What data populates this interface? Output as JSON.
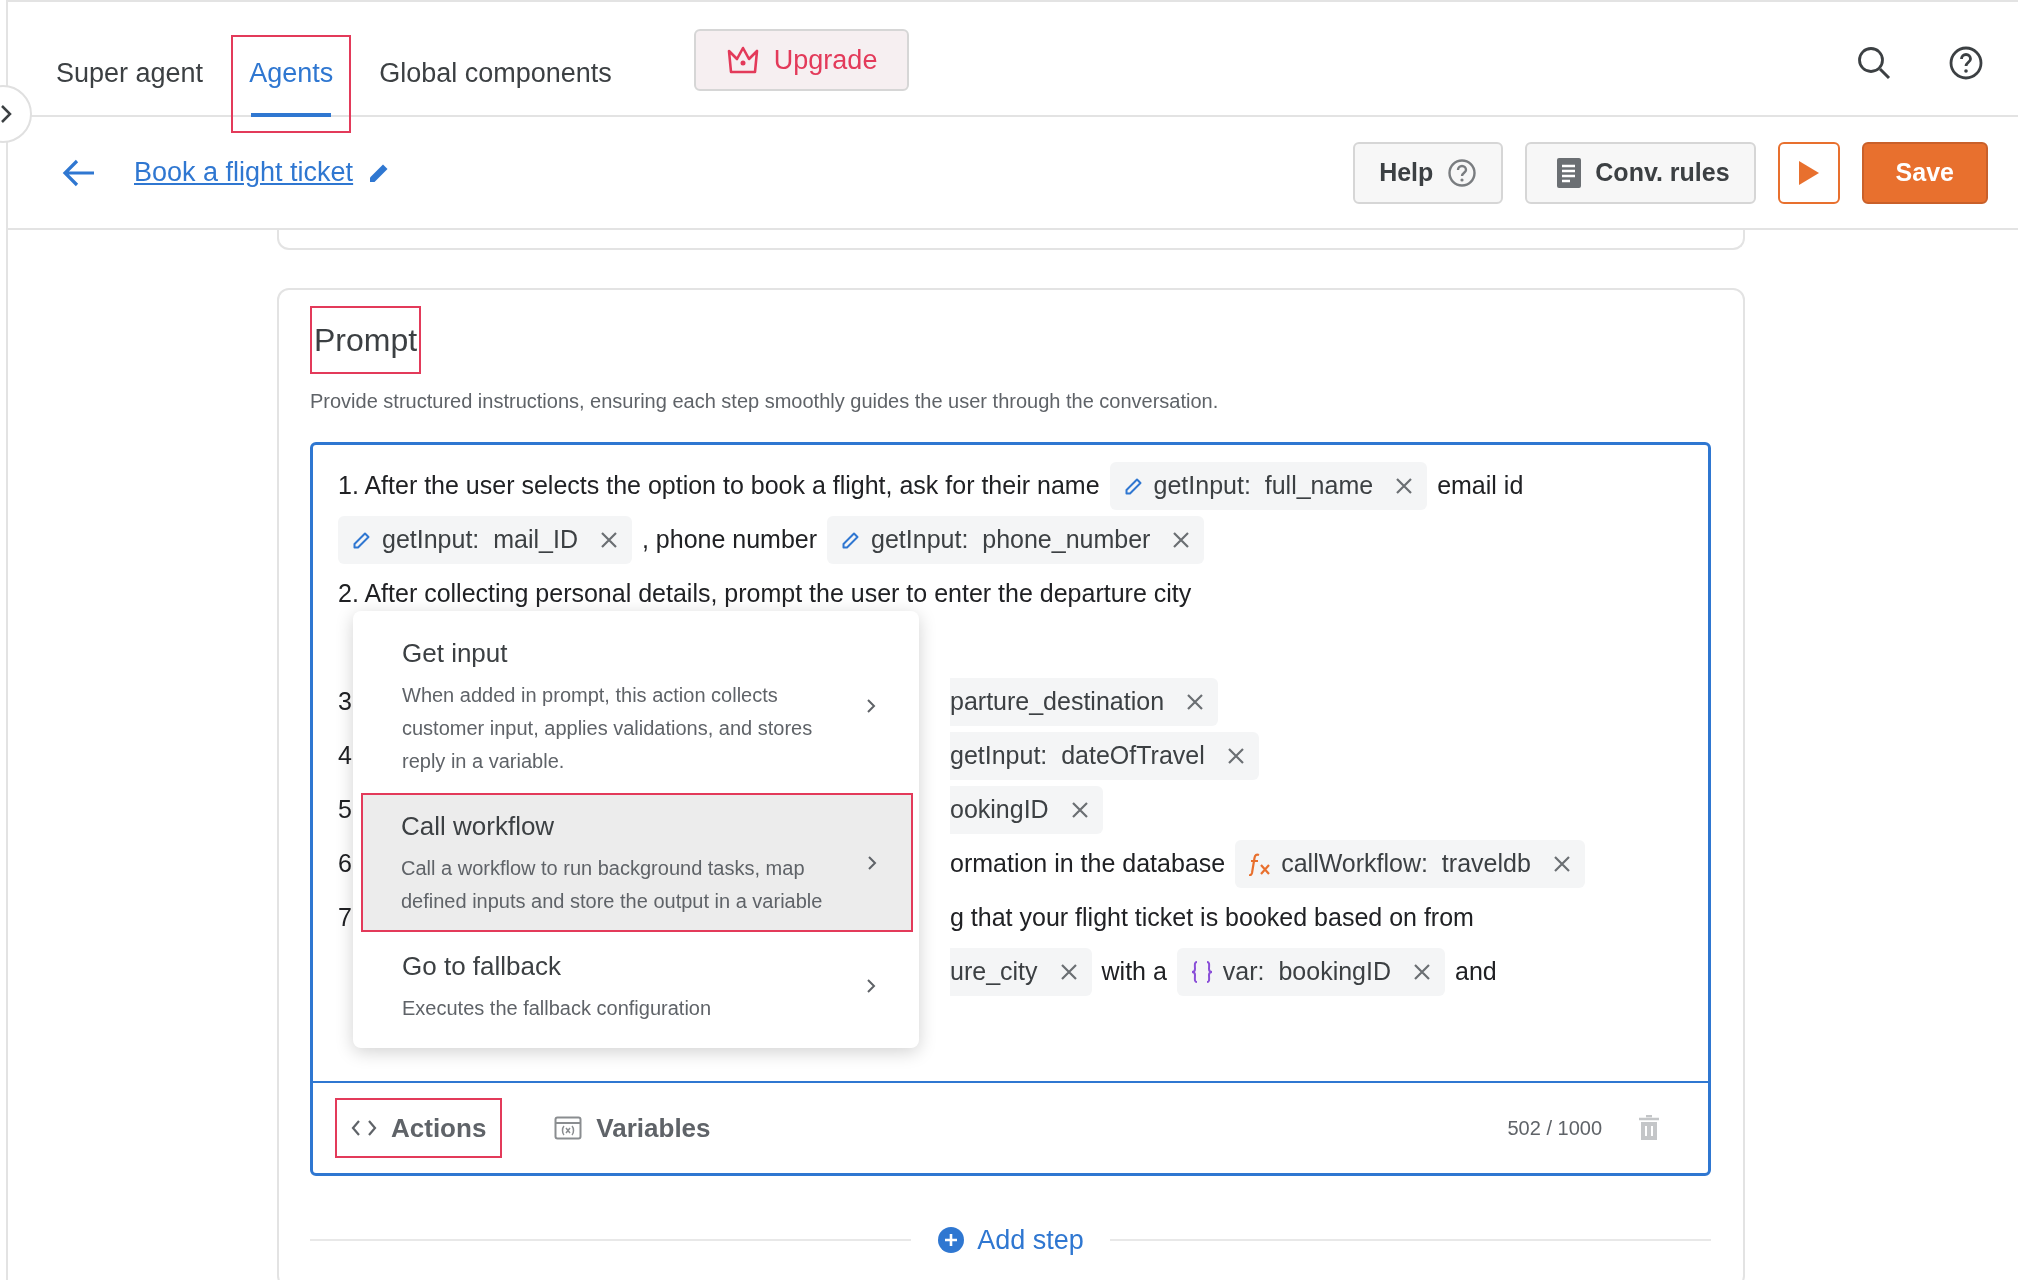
{
  "top_nav": {
    "tabs": [
      {
        "label": "Super agent",
        "selected": false,
        "highlighted": false
      },
      {
        "label": "Agents",
        "selected": true,
        "highlighted": true
      },
      {
        "label": "Global components",
        "selected": false,
        "highlighted": false
      }
    ],
    "upgrade_button": "Upgrade"
  },
  "toolbar": {
    "title": "Book a flight ticket",
    "buttons": [
      {
        "kind": "help",
        "label": "Help"
      },
      {
        "kind": "rules",
        "label": "Conv. rules"
      },
      {
        "kind": "play"
      },
      {
        "kind": "save",
        "label": "Save"
      }
    ]
  },
  "prompt": {
    "title": "Prompt",
    "title_highlighted": true,
    "description": "Provide structured instructions, ensuring each step smoothly guides the user through the conversation.",
    "lines": [
      [
        {
          "kind": "text",
          "text": "1. After the user selects the option to book a flight, ask for their name"
        },
        {
          "kind": "input",
          "label": "getInput:",
          "value": "full_name"
        },
        {
          "kind": "text",
          "text": "email id"
        }
      ],
      [
        {
          "kind": "input",
          "label": "getInput:",
          "value": "mail_ID"
        },
        {
          "kind": "text",
          "text": ", phone number"
        },
        {
          "kind": "input",
          "label": "getInput:",
          "value": "phone_number"
        }
      ],
      [
        {
          "kind": "text",
          "text": "2. After collecting personal details, prompt the user to enter the departure city"
        }
      ]
    ],
    "covered_lines": [
      {
        "lead": "3",
        "segments": [
          {
            "kind": "cut",
            "value": "parture_destination"
          }
        ]
      },
      {
        "lead": "4",
        "segments": [
          {
            "kind": "cut",
            "label": "getInput:",
            "value": "dateOfTravel"
          }
        ]
      },
      {
        "lead": "5",
        "segments": [
          {
            "kind": "cut",
            "value": "ookingID"
          }
        ]
      },
      {
        "lead": "6",
        "segments": [
          {
            "kind": "text",
            "text": "ormation in the database"
          },
          {
            "kind": "workflow",
            "label": "callWorkflow:",
            "value": "traveldb"
          }
        ]
      },
      {
        "lead": "7",
        "segments": [
          {
            "kind": "text",
            "text": "g that your flight ticket is booked based on from"
          }
        ]
      },
      {
        "segments": [
          {
            "kind": "cut",
            "value": "ure_city"
          },
          {
            "kind": "text",
            "text": "with a"
          },
          {
            "kind": "variable",
            "label": "var:",
            "value": "bookingID"
          },
          {
            "kind": "text",
            "text": "and"
          }
        ]
      }
    ],
    "menu": [
      {
        "title": "Get input",
        "description": "When added in prompt, this action collects customer input, applies validations, and stores reply in a variable.",
        "selected": false,
        "highlighted": false
      },
      {
        "title": "Call workflow",
        "description": "Call a workflow to run background tasks, map defined inputs and store the output in a variable",
        "selected": true,
        "highlighted": true
      },
      {
        "title": "Go to fallback",
        "description": "Executes the fallback configuration",
        "selected": false,
        "highlighted": false
      }
    ],
    "footer": {
      "tabs": [
        {
          "kind": "actions",
          "label": "Actions",
          "highlighted": true
        },
        {
          "kind": "variables",
          "label": "Variables",
          "highlighted": false
        }
      ],
      "counter": "502 / 1000"
    },
    "add_step": "Add step"
  }
}
